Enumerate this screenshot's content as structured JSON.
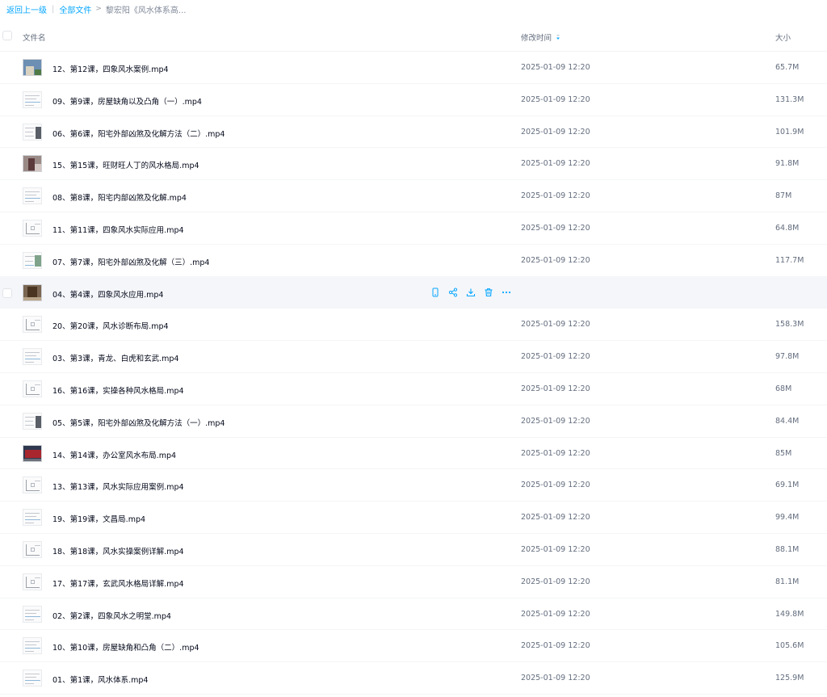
{
  "breadcrumb": {
    "back": "返回上一级",
    "separator": "|",
    "root": "全部文件",
    "arrow": ">",
    "current": "黎宏阳《风水体系高..."
  },
  "header": {
    "name": "文件名",
    "time": "修改时间",
    "size": "大小"
  },
  "colors": {
    "accent": "#06a7ff",
    "hover_row": "#f5f6fa",
    "text_primary": "#03081a",
    "text_secondary": "#636d7e"
  },
  "row_actions": [
    "phone-icon",
    "share-icon",
    "download-icon",
    "delete-icon",
    "more-icon"
  ],
  "files": [
    {
      "name": "12、第12课，四象风水案例.mp4",
      "time": "2025-01-09 12:20",
      "size": "65.7M",
      "thumb": "photo-blue"
    },
    {
      "name": "09、第9课，房屋缺角以及凸角（一）.mp4",
      "time": "2025-01-09 12:20",
      "size": "131.3M",
      "thumb": "doc"
    },
    {
      "name": "06、第6课，阳宅外部凶煞及化解方法（二）.mp4",
      "time": "2025-01-09 12:20",
      "size": "101.9M",
      "thumb": "doc-dark"
    },
    {
      "name": "15、第15课，旺财旺人丁的风水格局.mp4",
      "time": "2025-01-09 12:20",
      "size": "91.8M",
      "thumb": "photo-room"
    },
    {
      "name": "08、第8课，阳宅内部凶煞及化解.mp4",
      "time": "2025-01-09 12:20",
      "size": "87M",
      "thumb": "doc"
    },
    {
      "name": "11、第11课，四象风水实际应用.mp4",
      "time": "2025-01-09 12:20",
      "size": "64.8M",
      "thumb": "diagram"
    },
    {
      "name": "07、第7课，阳宅外部凶煞及化解（三）.mp4",
      "time": "2025-01-09 12:20",
      "size": "117.7M",
      "thumb": "doc-green"
    },
    {
      "name": "04、第4课，四象风水应用.mp4",
      "time": "",
      "size": "",
      "thumb": "photo-brown",
      "hover": true
    },
    {
      "name": "20、第20课，风水诊断布局.mp4",
      "time": "2025-01-09 12:20",
      "size": "158.3M",
      "thumb": "diagram"
    },
    {
      "name": "03、第3课，青龙、白虎和玄武.mp4",
      "time": "2025-01-09 12:20",
      "size": "97.8M",
      "thumb": "doc"
    },
    {
      "name": "16、第16课，实操各种风水格局.mp4",
      "time": "2025-01-09 12:20",
      "size": "68M",
      "thumb": "diagram"
    },
    {
      "name": "05、第5课，阳宅外部凶煞及化解方法（一）.mp4",
      "time": "2025-01-09 12:20",
      "size": "84.4M",
      "thumb": "doc-dark"
    },
    {
      "name": "14、第14课，办公室风水布局.mp4",
      "time": "2025-01-09 12:20",
      "size": "85M",
      "thumb": "photo-red"
    },
    {
      "name": "13、第13课，风水实际应用案例.mp4",
      "time": "2025-01-09 12:20",
      "size": "69.1M",
      "thumb": "diagram"
    },
    {
      "name": "19、第19课，文昌局.mp4",
      "time": "2025-01-09 12:20",
      "size": "99.4M",
      "thumb": "doc"
    },
    {
      "name": "18、第18课，风水实操案例详解.mp4",
      "time": "2025-01-09 12:20",
      "size": "88.1M",
      "thumb": "diagram"
    },
    {
      "name": "17、第17课，玄武风水格局详解.mp4",
      "time": "2025-01-09 12:20",
      "size": "81.1M",
      "thumb": "diagram"
    },
    {
      "name": "02、第2课，四象风水之明堂.mp4",
      "time": "2025-01-09 12:20",
      "size": "149.8M",
      "thumb": "doc"
    },
    {
      "name": "10、第10课，房屋缺角和凸角（二）.mp4",
      "time": "2025-01-09 12:20",
      "size": "105.6M",
      "thumb": "doc"
    },
    {
      "name": "01、第1课，风水体系.mp4",
      "time": "2025-01-09 12:20",
      "size": "125.9M",
      "thumb": "doc"
    }
  ]
}
